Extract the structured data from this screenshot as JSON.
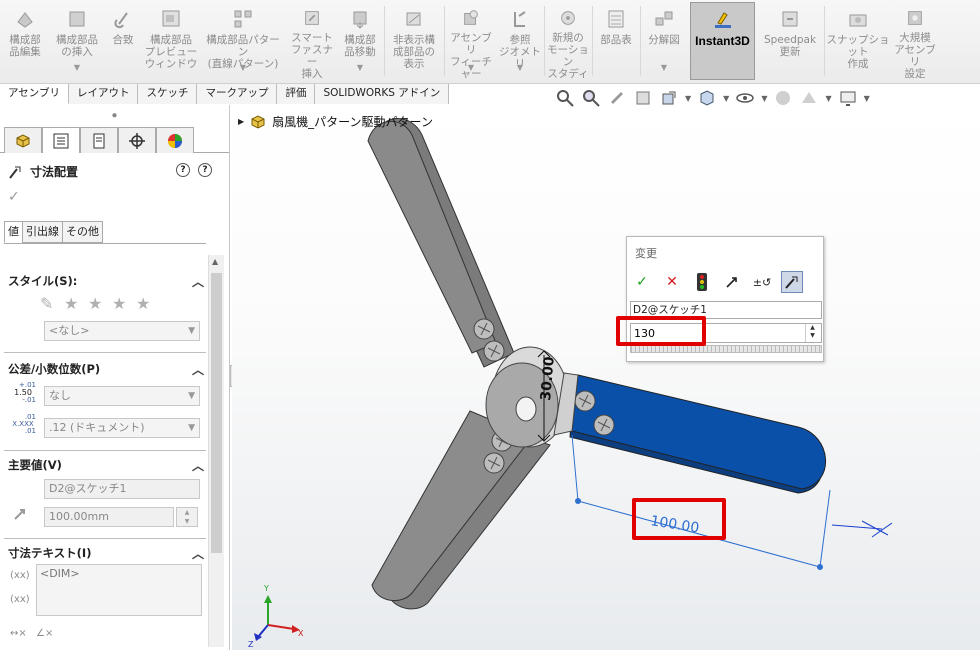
{
  "ribbon": {
    "items": [
      {
        "label": "構成部\n品編集",
        "icon": "edit-component-icon"
      },
      {
        "label": "構成部品\nの挿入",
        "icon": "insert-component-icon"
      },
      {
        "label": "合致",
        "icon": "mate-icon"
      },
      {
        "label": "構成部品\nプレビュー\nウィンドウ",
        "icon": "component-preview-icon"
      },
      {
        "label": "構成部品パターン\n(直線パターン)",
        "icon": "linear-pattern-icon"
      },
      {
        "label": "スマート\nファスナー\n挿入",
        "icon": "smart-fasteners-icon"
      },
      {
        "label": "構成部\n品移動",
        "icon": "move-component-icon"
      },
      {
        "label": "非表示構\n成部品の\n表示",
        "icon": "show-hidden-icon"
      },
      {
        "label": "アセンブリ\nフィーチャー",
        "icon": "assembly-feature-icon"
      },
      {
        "label": "参照\nジオメトリ",
        "icon": "reference-geometry-icon"
      },
      {
        "label": "新規の\nモーション\nスタディ",
        "icon": "motion-study-icon"
      },
      {
        "label": "部品表",
        "icon": "bom-icon"
      },
      {
        "label": "分解図",
        "icon": "exploded-view-icon"
      },
      {
        "label": "Instant3D",
        "icon": "instant3d-icon"
      },
      {
        "label": "Speedpak\n更新",
        "icon": "speedpak-icon"
      },
      {
        "label": "スナップショット\n作成",
        "icon": "snapshot-icon"
      },
      {
        "label": "大規模\nアセンブリ\n設定",
        "icon": "large-assembly-icon"
      }
    ]
  },
  "command_tabs": [
    "アセンブリ",
    "レイアウト",
    "スケッチ",
    "マークアップ",
    "評価",
    "SOLIDWORKS アドイン"
  ],
  "tree": {
    "root": "扇風機_パターン駆動パターン"
  },
  "property_manager": {
    "title": "寸法配置",
    "subtabs": [
      "値",
      "引出線",
      "その他"
    ],
    "style": {
      "header": "スタイル(S):",
      "select": "<なし>"
    },
    "tolerance": {
      "header": "公差/小数位数(P)",
      "tol_select": "なし",
      "prec_select": ".12 (ドキュメント)",
      "tol_icon_text": "1.50",
      "tol_icon_plus": "+.01",
      "tol_icon_minus": "-.01",
      "prec_icon_text": "X.XXX",
      "prec_icon_plus": ".01",
      "prec_icon_minus": ".01"
    },
    "primary": {
      "header": "主要値(V)",
      "name": "D2@スケッチ1",
      "value": "100.00mm"
    },
    "dim_text": {
      "header": "寸法テキスト(I)",
      "text": "<DIM>"
    }
  },
  "modify_dialog": {
    "title": "変更",
    "dimension_name": "D2@スケッチ1",
    "value": "130"
  },
  "model": {
    "dim_length": "100.00",
    "dim_hub": "30.00",
    "blade_color": "#0a4fa8",
    "highlight_color": "#e00000"
  }
}
